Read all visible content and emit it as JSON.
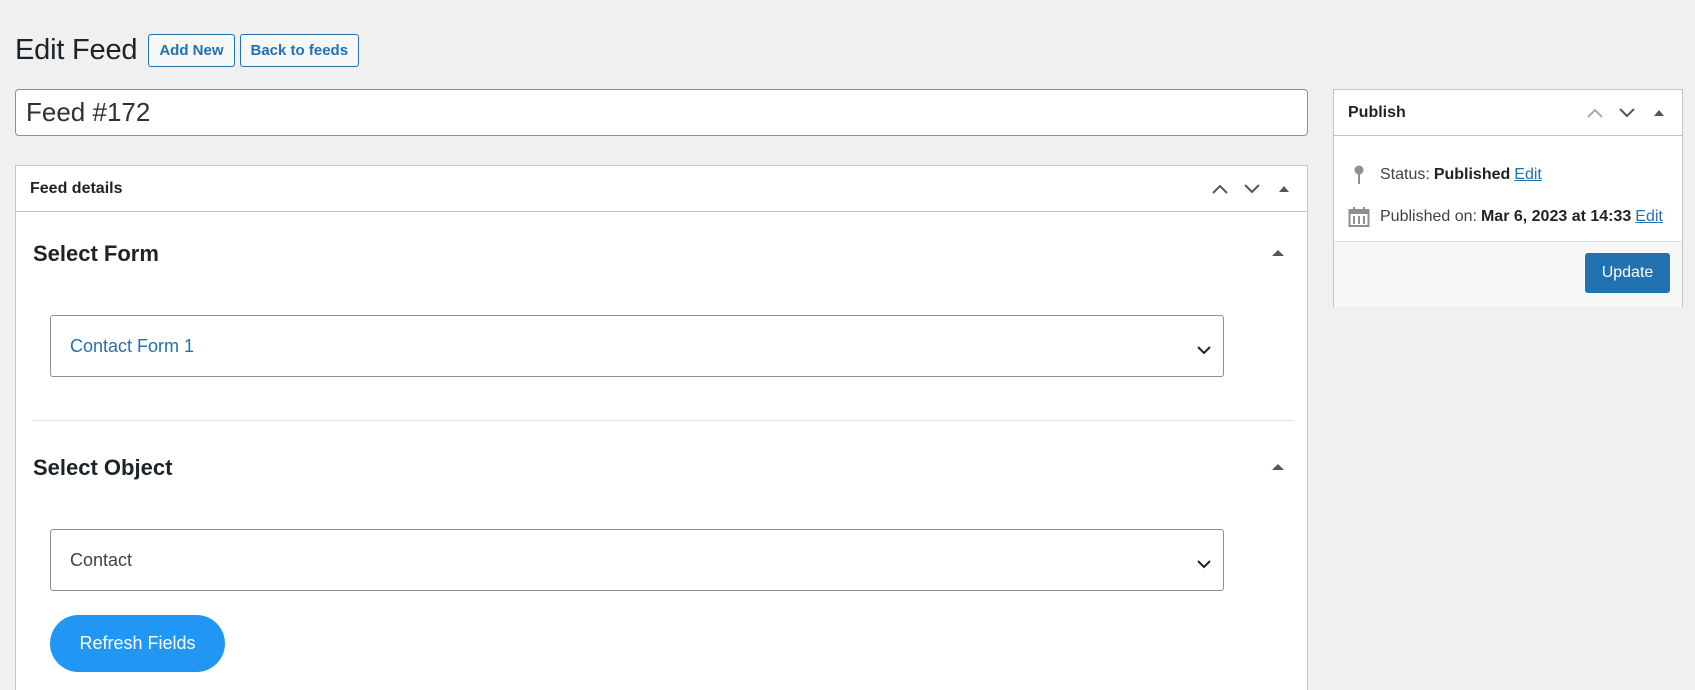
{
  "header": {
    "title": "Edit Feed",
    "add_new": "Add New",
    "back": "Back to feeds"
  },
  "post_title": {
    "value": "Feed #172"
  },
  "feed_details": {
    "title": "Feed details",
    "select_form": {
      "title": "Select Form",
      "value": "Contact Form 1"
    },
    "select_object": {
      "title": "Select Object",
      "value": "Contact"
    },
    "refresh_label": "Refresh Fields"
  },
  "publish": {
    "title": "Publish",
    "status_label": "Status:",
    "status_value": "Published",
    "status_edit": "Edit",
    "published_label": "Published on:",
    "published_value": "Mar 6, 2023 at 14:33",
    "published_edit": "Edit",
    "update_label": "Update"
  },
  "colors": {
    "accent": "#2271b1",
    "refresh": "#2196f3",
    "background": "#f0f0f1"
  },
  "icons": [
    "chevron-up-icon",
    "chevron-down-icon",
    "toggle-arrow-icon",
    "pin-icon",
    "calendar-icon"
  ]
}
